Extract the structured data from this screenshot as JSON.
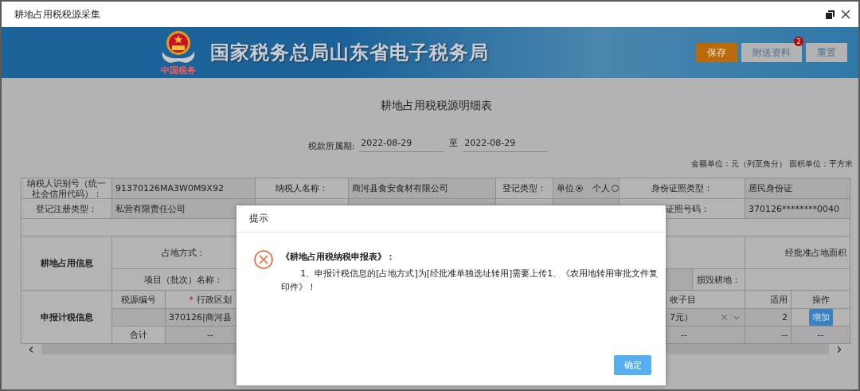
{
  "window": {
    "title": "耕地占用税税源采集"
  },
  "banner": {
    "title": "国家税务总局山东省电子税务局",
    "logo_caption": "中国税务",
    "buttons": [
      {
        "label": "保存",
        "kind": "primary"
      },
      {
        "label": "附送资料",
        "kind": "secondary",
        "badge": "2"
      },
      {
        "label": "重置",
        "kind": "secondary"
      }
    ]
  },
  "form": {
    "title": "耕地占用税税源明细表",
    "period": {
      "label": "税款所属期:",
      "from": "2022-08-29",
      "separator": "至",
      "to": "2022-08-29"
    },
    "units": "金额单位：元（列至角分） 面积单位：平方米"
  },
  "taxpayer": {
    "id_label": "纳税人识别号（统一社会信用代码）：",
    "id_value": "91370126MA3W0M9X92",
    "name_label": "纳税人名称：",
    "name_value": "商河县食安食材有限公司",
    "reg_kind_label": "登记类型：",
    "reg_kind_options": [
      {
        "label": "单位",
        "selected": true
      },
      {
        "label": "个人",
        "selected": false
      }
    ],
    "id_type_label": "身份证照类型：",
    "id_type_value": "居民身份证",
    "reg_type_label": "登记注册类型：",
    "reg_type_value": "私营有限责任公司",
    "id_number_label": "证照号码：",
    "id_number_value": "370126********0040"
  },
  "land_info": {
    "section": "耕地占用信息",
    "method_label": "占地方式：",
    "approved_area_label": "经批准占地面积",
    "project_label": "项目（批次）名称：",
    "damaged_label": "损毁耕地："
  },
  "declaration": {
    "section": "申报计税信息",
    "columns": [
      {
        "label": "税源编号"
      },
      {
        "label": "行政区划",
        "required_mark": "*"
      },
      {
        "label": "收子目"
      },
      {
        "label": "适用"
      },
      {
        "label": "操作"
      }
    ],
    "row": {
      "district": "370126|商河县",
      "item": "7元）",
      "rate": "2",
      "action": "增加"
    },
    "total": {
      "label": "合计",
      "values": [
        "--",
        "--",
        "--",
        "--"
      ]
    }
  },
  "dialog": {
    "title": "提示",
    "heading": "《耕地占用税纳税申报表》：",
    "message": "1、申报计税信息的[占地方式]为[经批准单独选址转用]需要上传1、《农用地转用审批文件复印件》！",
    "ok": "确定"
  }
}
